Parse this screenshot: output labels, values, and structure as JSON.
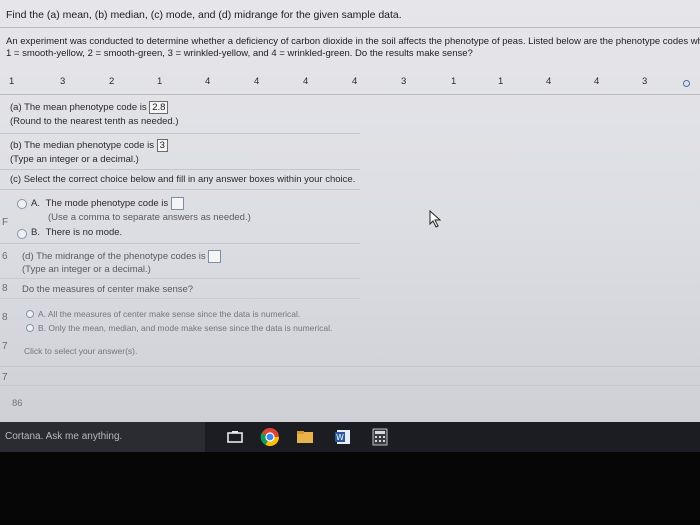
{
  "question": {
    "header": "Find the (a) mean, (b) median, (c) mode, and (d) midrange for the given sample data.",
    "prompt_line1": "An experiment was conducted to determine whether a deficiency of carbon dioxide in the soil affects the phenotype of peas. Listed below are the phenotype codes whe",
    "prompt_line2": "1 = smooth-yellow, 2 = smooth-green, 3 = wrinkled-yellow, and 4 = wrinkled-green. Do the results make sense?",
    "data_values": [
      "1",
      "3",
      "2",
      "1",
      "4",
      "4",
      "4",
      "4",
      "3",
      "1",
      "1",
      "4",
      "4",
      "3"
    ]
  },
  "part_a": {
    "label": "(a) The mean phenotype code is",
    "answer": "2.8",
    "hint": "(Round to the nearest tenth as needed.)"
  },
  "part_b": {
    "label": "(b) The median phenotype code is",
    "answer": "3",
    "hint": "(Type an integer or a decimal.)"
  },
  "part_c": {
    "instruction": "(c) Select the correct choice below and fill in any answer boxes within your choice.",
    "option_a_letter": "A.",
    "option_a_text": "The mode phenotype code is",
    "option_a_hint": "(Use a comma to separate answers as needed.)",
    "option_b_letter": "B.",
    "option_b_text": "There is no mode."
  },
  "part_d": {
    "label": "(d) The midrange of the phenotype codes is",
    "hint": "(Type an integer or a decimal.)"
  },
  "part_e": {
    "question": "Do the measures of center make sense?",
    "option_a": "A.  All the measures of center make sense since the data is numerical.",
    "option_b": "B.  Only the mean, median, and mode make sense since the data is numerical.",
    "footer": "Click to select your answer(s)."
  },
  "left_markers": [
    "F",
    "6",
    "8",
    "8",
    "7",
    "7"
  ],
  "page_number": "86",
  "taskbar": {
    "search_text": "Cortana. Ask me anything."
  },
  "colors": {
    "screen_bg": "#e0e1e6",
    "taskbar": "#1c1d22",
    "radio": "#8896a8"
  }
}
